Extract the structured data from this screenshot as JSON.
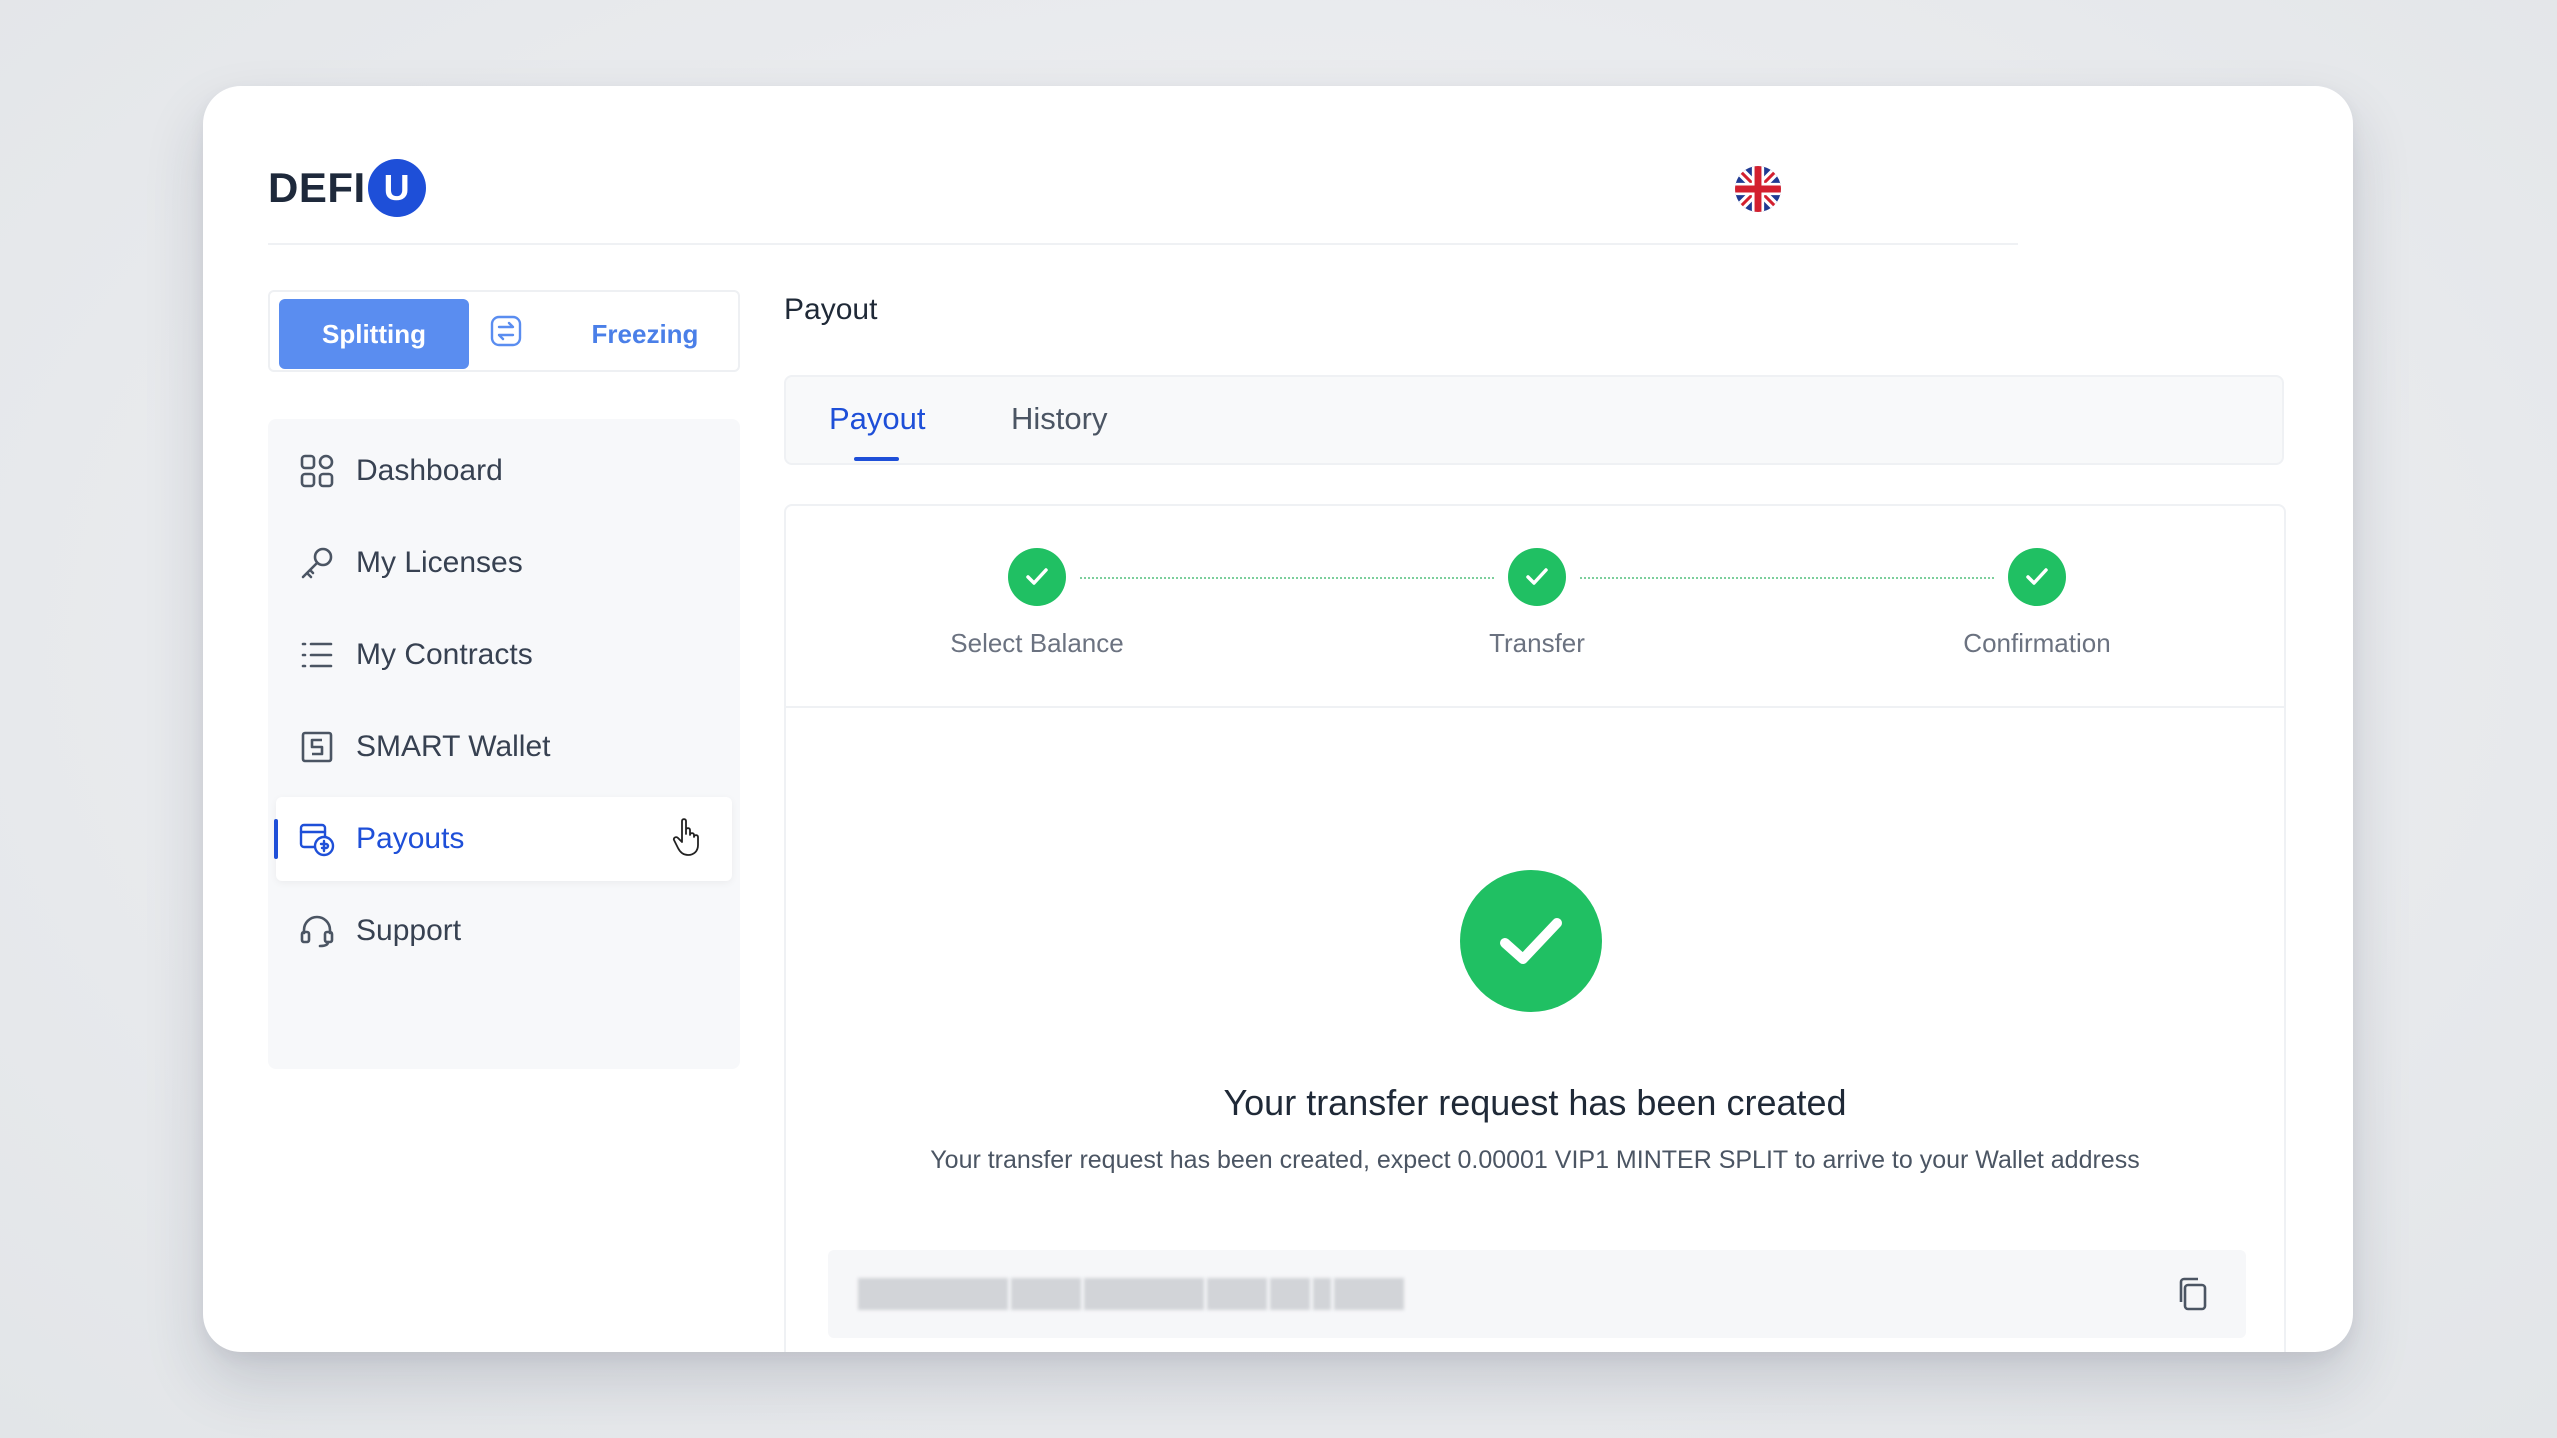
{
  "app": {
    "logo_text": "DEFI",
    "logo_badge": "U",
    "language_icon": "uk-flag-icon"
  },
  "mode_toggle": {
    "splitting_label": "Splitting",
    "swap_icon": "swap-icon",
    "freezing_label": "Freezing"
  },
  "sidebar": {
    "items": [
      {
        "label": "Dashboard",
        "icon": "grid-icon"
      },
      {
        "label": "My Licenses",
        "icon": "key-icon"
      },
      {
        "label": "My Contracts",
        "icon": "list-icon"
      },
      {
        "label": "SMART Wallet",
        "icon": "wallet-icon"
      },
      {
        "label": "Payouts",
        "icon": "payouts-icon",
        "active": true
      },
      {
        "label": "Support",
        "icon": "headset-icon"
      }
    ]
  },
  "main": {
    "page_title": "Payout",
    "tabs": [
      {
        "label": "Payout",
        "active": true
      },
      {
        "label": "History",
        "active": false
      }
    ],
    "steps": [
      {
        "label": "Select Balance",
        "done": true
      },
      {
        "label": "Transfer",
        "done": true
      },
      {
        "label": "Confirmation",
        "done": true
      }
    ],
    "success_title": "Your transfer request has been created",
    "success_description": "Your transfer request has been created, expect 0.00001 VIP1 MINTER SPLIT to arrive to your Wallet address"
  },
  "colors": {
    "primary": "#1e4fd8",
    "toggle_active": "#5a8df0",
    "success": "#20c063"
  }
}
